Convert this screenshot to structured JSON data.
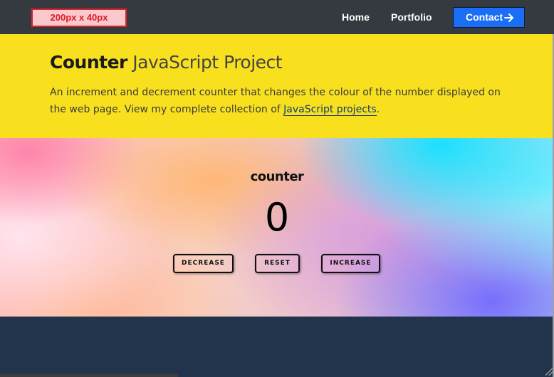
{
  "navbar": {
    "logo_text": "200px x 40px",
    "links": [
      "Home",
      "Portfolio"
    ],
    "contact_label": "Contact"
  },
  "hero": {
    "title_strong": "Counter",
    "title_rest": " JavaScript Project",
    "description_text": "An increment and decrement counter that changes the colour of the number displayed on the web page. View my complete collection of ",
    "link_text": "JavaScript projects",
    "description_end": "."
  },
  "counter": {
    "title": "counter",
    "value": "0",
    "buttons": {
      "decrease": "DECREASE",
      "reset": "RESET",
      "increase": "INCREASE"
    }
  },
  "colors": {
    "navbar": "#343a40",
    "hero_background": "#f8e01f",
    "contact_button": "#1a6ef5",
    "footer": "#22344b",
    "logo_text": "#e01b24"
  },
  "icons": {
    "contact": "arrow-right-icon"
  }
}
